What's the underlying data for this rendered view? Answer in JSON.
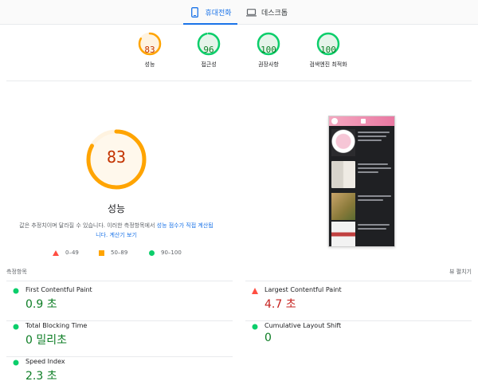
{
  "tabs": {
    "mobile": "휴대전화",
    "desktop": "데스크톱"
  },
  "colors": {
    "good": "#0cce6b",
    "average": "#ffa400",
    "poor": "#ff4e42",
    "link": "#1a73e8"
  },
  "summary": [
    {
      "score": "83",
      "label": "성능",
      "status": "average"
    },
    {
      "score": "96",
      "label": "접근성",
      "status": "good"
    },
    {
      "score": "100",
      "label": "권장사항",
      "status": "good"
    },
    {
      "score": "100",
      "label": "검색엔진 최적화",
      "status": "good"
    }
  ],
  "performance": {
    "score": "83",
    "title": "성능",
    "note_prefix": "값은 추정치이며 달라질 수 있습니다. 이러한 측정항목에서 ",
    "note_link1": "성능 점수가 직접 계산됩",
    "note_link2": "니다.",
    "note_link3": "계산기 보기"
  },
  "legend": {
    "poor": "0–49",
    "average": "50–89",
    "good": "90–100"
  },
  "metrics_header": {
    "title": "측정항목",
    "toggle": "뷰 펼치기"
  },
  "metrics": [
    {
      "name": "First Contentful Paint",
      "value": "0.9 초",
      "status": "good"
    },
    {
      "name": "Largest Contentful Paint",
      "value": "4.7 초",
      "status": "poor"
    },
    {
      "name": "Total Blocking Time",
      "value": "0 밀리초",
      "status": "good"
    },
    {
      "name": "Cumulative Layout Shift",
      "value": "0",
      "status": "good"
    },
    {
      "name": "Speed Index",
      "value": "2.3 초",
      "status": "good"
    }
  ]
}
